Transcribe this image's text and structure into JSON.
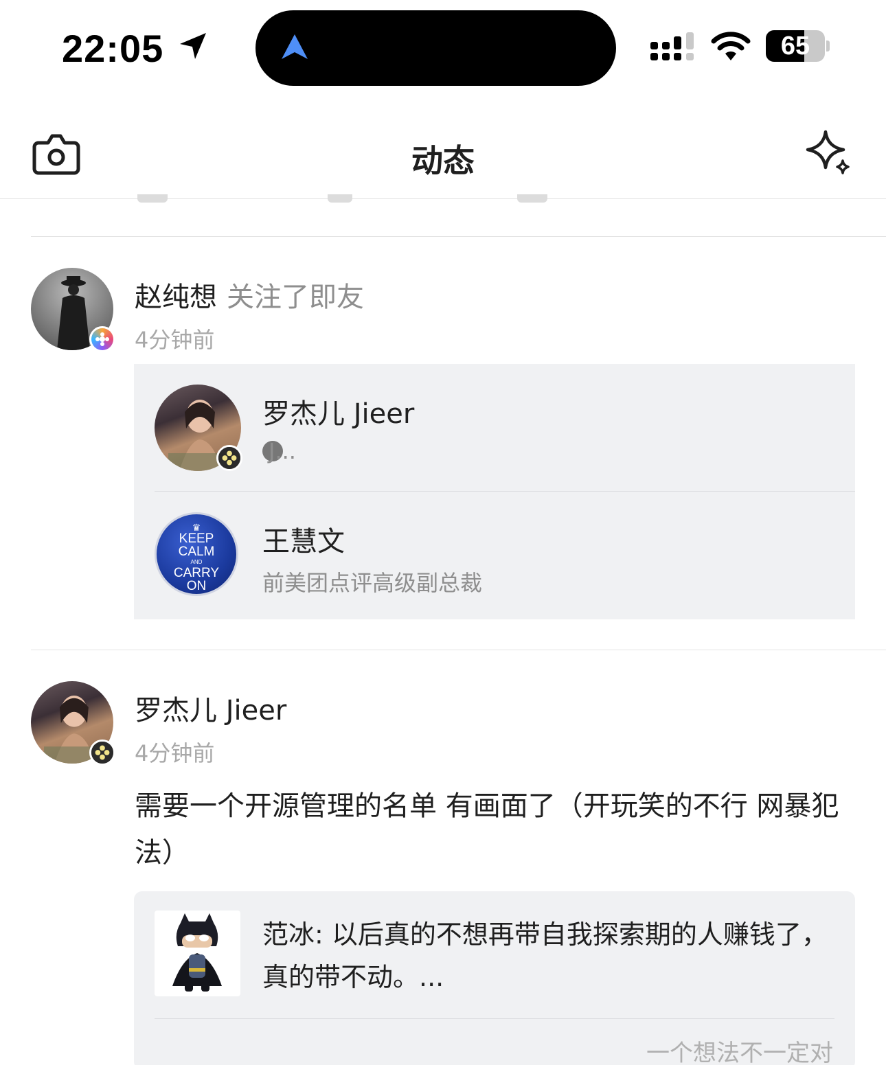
{
  "status_bar": {
    "time": "22:05",
    "battery": "65",
    "battery_level": 0.65
  },
  "nav": {
    "title": "动态"
  },
  "colors": {
    "island_nav_arrow": "#4f8ff7",
    "secondary_text": "#8e8e8e",
    "card_background": "#f0f1f3"
  },
  "feed": [
    {
      "author": "赵纯想",
      "action": "关注了即友",
      "time": "4分钟前",
      "followed_users": [
        {
          "name": "罗杰儿 Jieer",
          "subtitle": "J...",
          "subtitle_icon": "j-circle-icon"
        },
        {
          "name": "王慧文",
          "subtitle": "前美团点评高级副总裁",
          "avatar_text": [
            "KEEP",
            "CALM",
            "AND",
            "CARRY",
            "ON"
          ]
        }
      ]
    },
    {
      "author": "罗杰儿 Jieer",
      "time": "4分钟前",
      "text": "需要一个开源管理的名单 有画面了（开玩笑的不行 网暴犯法）",
      "quote": {
        "text": "范冰: 以后真的不想再带自我探索期的人赚钱了，真的带不动。...",
        "source": "一个想法不一定对"
      }
    }
  ]
}
